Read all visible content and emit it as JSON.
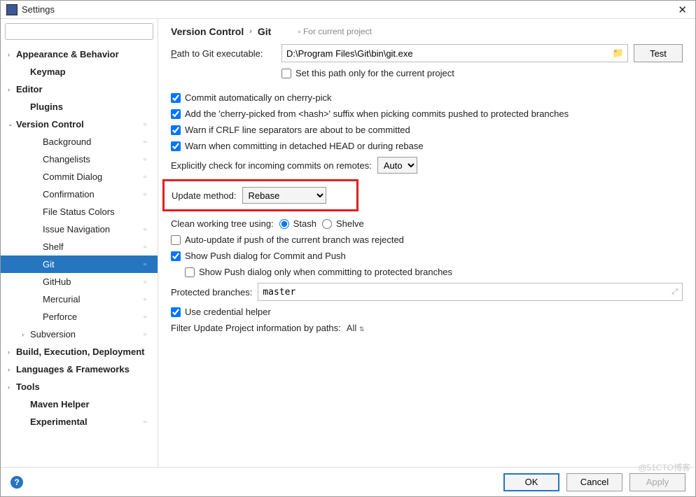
{
  "window": {
    "title": "Settings"
  },
  "search": {
    "placeholder": ""
  },
  "sidebar": {
    "items": [
      {
        "label": "Appearance & Behavior",
        "bold": true,
        "arrow": "›",
        "indent": 0
      },
      {
        "label": "Keymap",
        "bold": true,
        "indent": 1
      },
      {
        "label": "Editor",
        "bold": true,
        "arrow": "›",
        "indent": 0
      },
      {
        "label": "Plugins",
        "bold": true,
        "indent": 1
      },
      {
        "label": "Version Control",
        "bold": true,
        "arrow": "⌄",
        "indent": 0,
        "cfg": true
      },
      {
        "label": "Background",
        "indent": 2,
        "cfg": true
      },
      {
        "label": "Changelists",
        "indent": 2,
        "cfg": true
      },
      {
        "label": "Commit Dialog",
        "indent": 2,
        "cfg": true
      },
      {
        "label": "Confirmation",
        "indent": 2,
        "cfg": true
      },
      {
        "label": "File Status Colors",
        "indent": 2
      },
      {
        "label": "Issue Navigation",
        "indent": 2,
        "cfg": true
      },
      {
        "label": "Shelf",
        "indent": 2,
        "cfg": true
      },
      {
        "label": "Git",
        "indent": 2,
        "cfg": true,
        "selected": true
      },
      {
        "label": "GitHub",
        "indent": 2,
        "cfg": true
      },
      {
        "label": "Mercurial",
        "indent": 2,
        "cfg": true
      },
      {
        "label": "Perforce",
        "indent": 2,
        "cfg": true
      },
      {
        "label": "Subversion",
        "arrow": "›",
        "indent": 1,
        "cfg": true
      },
      {
        "label": "Build, Execution, Deployment",
        "bold": true,
        "arrow": "›",
        "indent": 0
      },
      {
        "label": "Languages & Frameworks",
        "bold": true,
        "arrow": "›",
        "indent": 0
      },
      {
        "label": "Tools",
        "bold": true,
        "arrow": "›",
        "indent": 0
      },
      {
        "label": "Maven Helper",
        "bold": true,
        "indent": 1
      },
      {
        "label": "Experimental",
        "bold": true,
        "indent": 1,
        "cfg": true
      }
    ]
  },
  "breadcrumb": {
    "a": "Version Control",
    "b": "Git",
    "badge": "For current project"
  },
  "git": {
    "path_label": "Path to Git executable:",
    "path_value": "D:\\Program Files\\Git\\bin\\git.exe",
    "test_btn": "Test",
    "set_only_project": "Set this path only for the current project",
    "commit_auto": "Commit automatically on cherry-pick",
    "add_suffix": "Add the 'cherry-picked from <hash>' suffix when picking commits pushed to protected branches",
    "warn_crlf": "Warn if CRLF line separators are about to be committed",
    "warn_detached": "Warn when committing in detached HEAD or during rebase",
    "explicit_check": "Explicitly check for incoming commits on remotes:",
    "explicit_val": "Auto",
    "update_method_label": "Update method:",
    "update_method_val": "Rebase",
    "clean_tree_label": "Clean working tree using:",
    "stash": "Stash",
    "shelve": "Shelve",
    "auto_update": "Auto-update if push of the current branch was rejected",
    "show_push": "Show Push dialog for Commit and Push",
    "show_push_only": "Show Push dialog only when committing to protected branches",
    "protected_label": "Protected branches:",
    "protected_val": "master",
    "cred_helper": "Use credential helper",
    "filter_label": "Filter Update Project information by paths:",
    "filter_val": "All"
  },
  "footer": {
    "ok": "OK",
    "cancel": "Cancel",
    "apply": "Apply"
  },
  "watermark": "@51CTO博客"
}
